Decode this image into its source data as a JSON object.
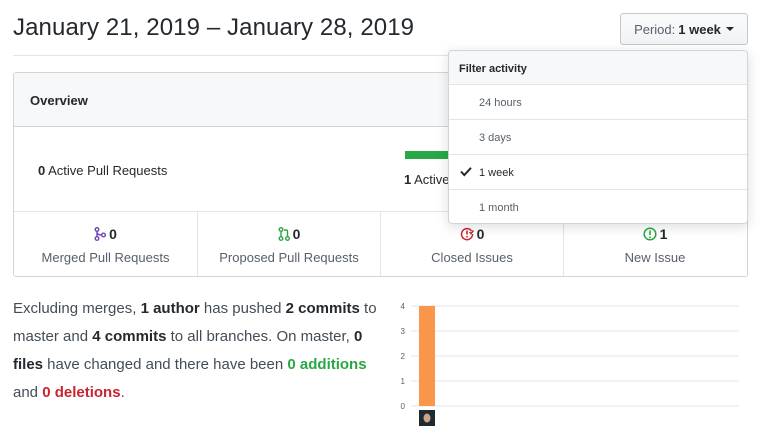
{
  "header": {
    "title": "January 21, 2019 – January 28, 2019",
    "period_label": "Period:",
    "period_value": "1 week"
  },
  "dropdown": {
    "heading": "Filter activity",
    "options": [
      {
        "label": "24 hours",
        "selected": false
      },
      {
        "label": "3 days",
        "selected": false
      },
      {
        "label": "1 week",
        "selected": true
      },
      {
        "label": "1 month",
        "selected": false
      }
    ]
  },
  "overview": {
    "heading": "Overview",
    "active_prs_count": "0",
    "active_prs_label": "Active Pull Requests",
    "active_issues_count": "1",
    "active_issues_label": "Active",
    "stats": [
      {
        "count": "0",
        "label": "Merged Pull Requests",
        "icon": "git-merge-icon",
        "color": "#6f42c1"
      },
      {
        "count": "0",
        "label": "Proposed Pull Requests",
        "icon": "git-pull-request-icon",
        "color": "#28a745"
      },
      {
        "count": "0",
        "label": "Closed Issues",
        "icon": "issue-closed-icon",
        "color": "#cb2431"
      },
      {
        "count": "1",
        "label": "New Issue",
        "icon": "issue-opened-icon",
        "color": "#28a745"
      }
    ]
  },
  "summary": {
    "t1": "Excluding merges, ",
    "authors": "1 author",
    "t2": " has pushed ",
    "commits_master": "2 commits",
    "t3": " to master and ",
    "commits_all": "4 commits",
    "t4": " to all branches. On master, ",
    "files": "0 files",
    "t5": " have changed and there have been ",
    "additions": "0 additions",
    "t6": " and ",
    "deletions": "0 deletions",
    "t7": "."
  },
  "chart_data": {
    "type": "bar",
    "categories": [
      "author"
    ],
    "values": [
      4
    ],
    "ylim": [
      0,
      4
    ],
    "yticks": [
      "0",
      "1",
      "2",
      "3",
      "4"
    ],
    "bar_color": "#f9964a",
    "grid": true
  }
}
